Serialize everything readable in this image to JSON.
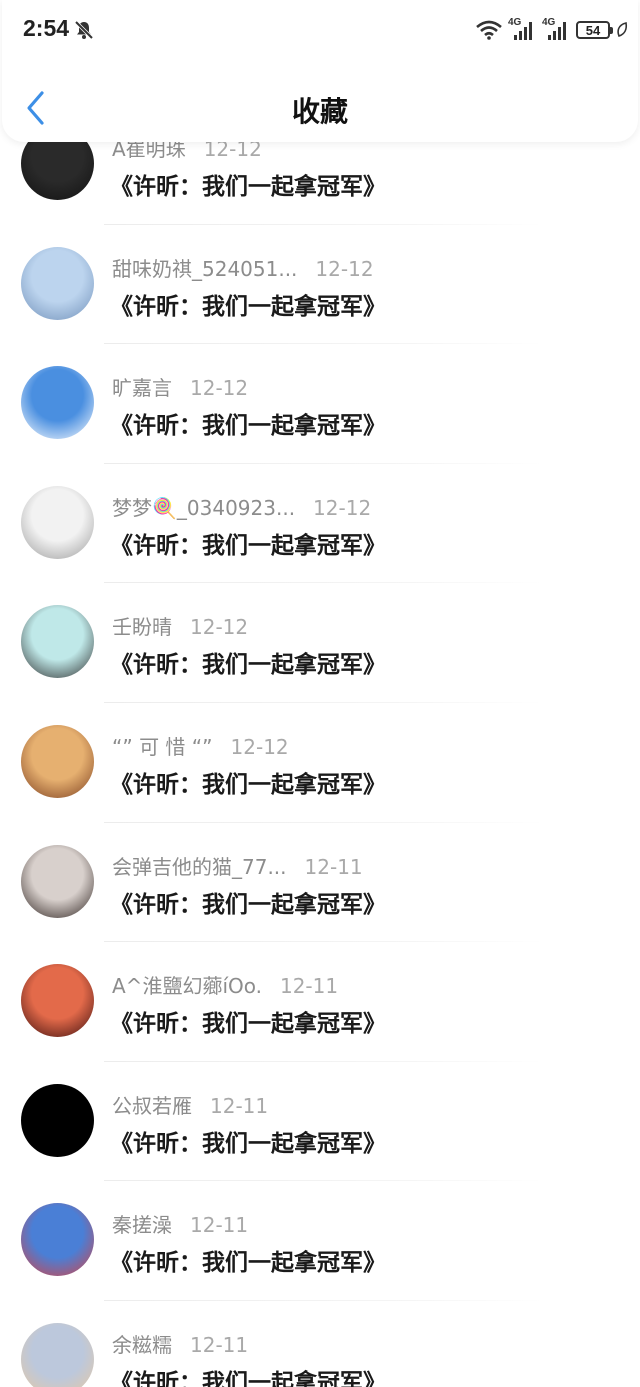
{
  "status": {
    "time": "2:54",
    "signal_1": "4G",
    "signal_2": "4G",
    "battery": "54"
  },
  "header": {
    "title": "收藏"
  },
  "items": [
    {
      "name": "A崔明珠",
      "date": "12-12",
      "content": "《许昕：我们一起拿冠军》",
      "avatar_colors": [
        "#2a2a2a",
        "#111111"
      ]
    },
    {
      "name": "甜味奶祺_524051...",
      "date": "12-12",
      "content": "《许昕：我们一起拿冠军》",
      "avatar_colors": [
        "#bcd4ee",
        "#6f8fb8"
      ]
    },
    {
      "name": "旷嘉言",
      "date": "12-12",
      "content": "《许昕：我们一起拿冠军》",
      "avatar_colors": [
        "#4a8fe0",
        "#ffffff"
      ]
    },
    {
      "name": "梦梦🍭_0340923...",
      "date": "12-12",
      "content": "《许昕：我们一起拿冠军》",
      "avatar_colors": [
        "#f2f2f2",
        "#9a9a9a"
      ]
    },
    {
      "name": "壬盼晴",
      "date": "12-12",
      "content": "《许昕：我们一起拿冠军》",
      "avatar_colors": [
        "#bfe8e8",
        "#2a2a2a"
      ]
    },
    {
      "name": "“” 可 惜 “”",
      "date": "12-12",
      "content": "《许昕：我们一起拿冠军》",
      "avatar_colors": [
        "#e6b070",
        "#7a3d1e"
      ]
    },
    {
      "name": "会弹吉他的猫_77...",
      "date": "12-11",
      "content": "《许昕：我们一起拿冠军》",
      "avatar_colors": [
        "#d8d0cc",
        "#2a1f1c"
      ]
    },
    {
      "name": "A^淮鹽幻薌íOo.",
      "date": "12-11",
      "content": "《许昕：我们一起拿冠军》",
      "avatar_colors": [
        "#e36a4a",
        "#3a0d0d"
      ]
    },
    {
      "name": "公叔若雁",
      "date": "12-11",
      "content": "《许昕：我们一起拿冠军》",
      "avatar_colors": [
        "#000000",
        "#000000"
      ]
    },
    {
      "name": "秦搓澡",
      "date": "12-11",
      "content": "《许昕：我们一起拿冠军》",
      "avatar_colors": [
        "#4a7fd6",
        "#d94040"
      ]
    },
    {
      "name": "余糍糯",
      "date": "12-11",
      "content": "《许昕：我们一起拿冠军》",
      "avatar_colors": [
        "#bcc8dc",
        "#e8c9a0"
      ]
    }
  ]
}
